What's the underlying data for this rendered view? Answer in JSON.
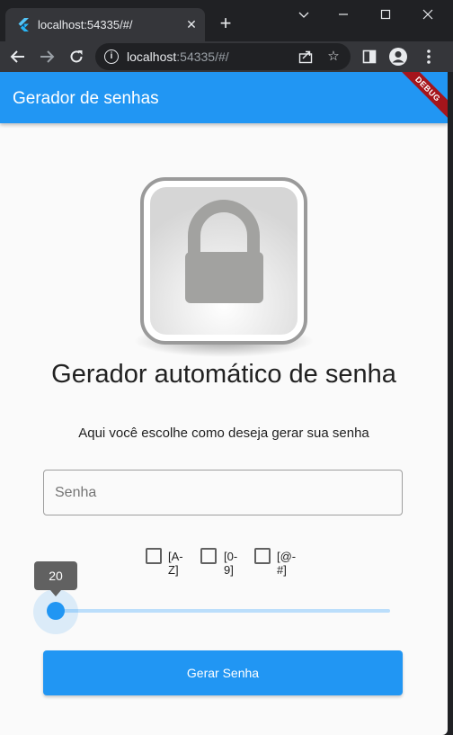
{
  "browser": {
    "tab_title": "localhost:54335/#/",
    "tab_close_icon": "close-icon",
    "new_tab_icon": "plus-icon",
    "window_controls": [
      "chevron-down-icon",
      "minimize-icon",
      "maximize-icon",
      "close-icon"
    ],
    "toolbar": {
      "back_icon": "arrow-left-icon",
      "forward_icon": "arrow-right-icon",
      "reload_icon": "reload-icon",
      "url_host": "localhost",
      "url_rest": ":54335/#/",
      "share_icon": "share-icon",
      "bookmark_icon": "star-icon",
      "sidepanel_icon": "side-panel-icon",
      "profile_icon": "profile-icon",
      "menu_icon": "kebab-menu-icon"
    }
  },
  "app": {
    "title": "Gerador de senhas",
    "debug_banner": "DEBUG",
    "accent_color": "#2196f3",
    "heading": "Gerador automático de senha",
    "subtitle": "Aqui você escolhe como deseja gerar sua senha",
    "password_field": {
      "placeholder": "Senha",
      "value": ""
    },
    "options": [
      {
        "label": "[A-Z]",
        "checked": false
      },
      {
        "label": "[0-9]",
        "checked": false
      },
      {
        "label": "[@-#]",
        "checked": false
      }
    ],
    "slider": {
      "value": "20",
      "fraction": 0
    },
    "generate_button": "Gerar Senha"
  }
}
